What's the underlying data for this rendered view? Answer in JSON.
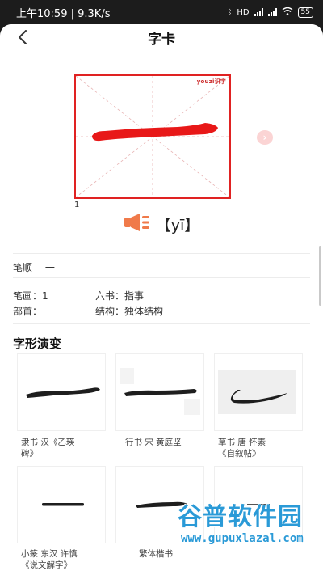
{
  "status": {
    "time": "上午10:59",
    "speed": "9.3K/s",
    "network_label": "HD",
    "battery": "55"
  },
  "header": {
    "title": "字卡",
    "back_icon": "chevron-left-icon"
  },
  "character_card": {
    "character": "一",
    "brand": "youzi识字",
    "stroke_index": "1",
    "pinyin": "【yī】",
    "speaker_icon": "speaker-icon",
    "next_icon": "chevron-right-icon",
    "stroke_color": "#e81818",
    "border_color": "#e02222"
  },
  "stroke_order": {
    "label": "笔顺",
    "value": "一"
  },
  "info": {
    "strokes_label": "笔画：",
    "strokes_value": "1",
    "liushu_label": "六书：",
    "liushu_value": "指事",
    "radical_label": "部首：",
    "radical_value": "一",
    "structure_label": "结构：",
    "structure_value": "独体结构"
  },
  "evolution": {
    "title": "字形演变",
    "items": [
      {
        "caption_line1": "隶书 汉《乙瑛",
        "caption_line2": "碑》"
      },
      {
        "caption_line1": "行书 宋 黄庭坚",
        "caption_line2": ""
      },
      {
        "caption_line1": "草书 唐 怀素",
        "caption_line2": "《自叙帖》"
      },
      {
        "caption_line1": "小篆 东汉 许慎",
        "caption_line2": "《说文解字》"
      },
      {
        "caption_line1": "繁体楷书",
        "caption_line2": ""
      },
      {
        "caption_line1": "",
        "caption_line2": ""
      }
    ]
  },
  "watermark": {
    "title": "谷普软件园",
    "url": "www.gupuxlazal.com"
  }
}
